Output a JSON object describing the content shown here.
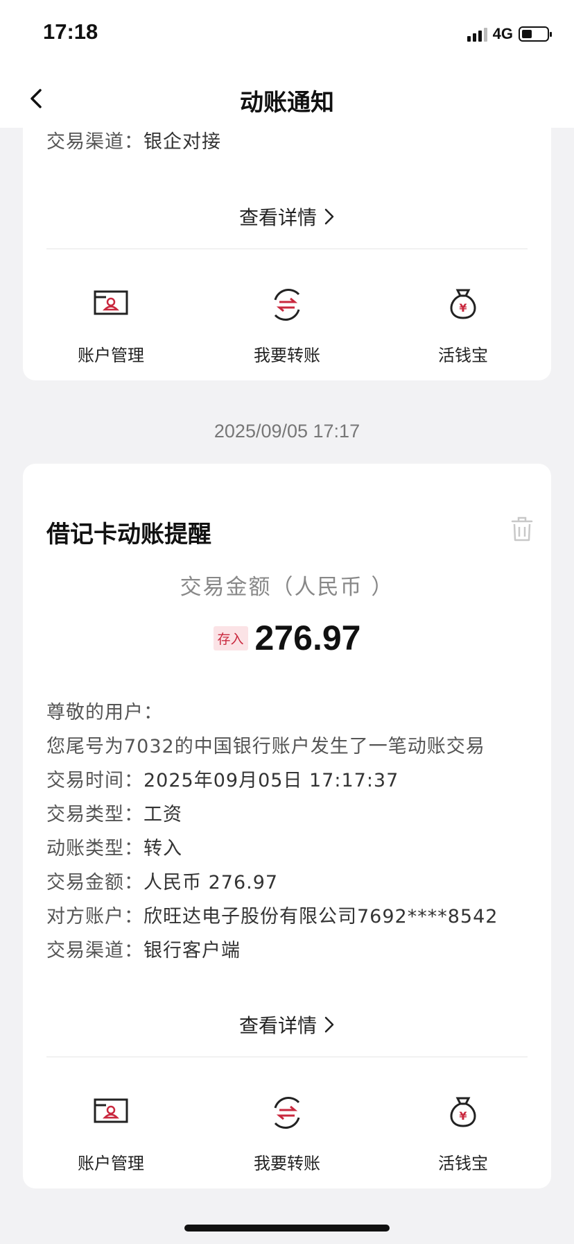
{
  "status_bar": {
    "time": "17:18",
    "network": "4G",
    "battery_level": 0.4
  },
  "nav": {
    "title": "动账通知"
  },
  "top_card": {
    "channel_label": "交易渠道：",
    "channel_value": "银企对接",
    "detail_link": "查看详情"
  },
  "actions": [
    {
      "label": "账户管理",
      "icon": "account-card-icon"
    },
    {
      "label": "我要转账",
      "icon": "transfer-icon"
    },
    {
      "label": "活钱宝",
      "icon": "money-bag-icon"
    }
  ],
  "notification": {
    "date": "2025/09/05 17:17",
    "title": "借记卡动账提醒",
    "amount_label": "交易金额（人民币 ）",
    "badge": "存入",
    "amount": "276.97",
    "greeting": "尊敬的用户：",
    "message": "您尾号为7032的中国银行账户发生了一笔动账交易",
    "fields": [
      {
        "label": "交易时间：",
        "value": "2025年09月05日 17:17:37"
      },
      {
        "label": "交易类型：",
        "value": "工资"
      },
      {
        "label": "动账类型：",
        "value": "转入"
      },
      {
        "label": "交易金额：",
        "value": "人民币 276.97"
      },
      {
        "label": "对方账户：",
        "value": "欣旺达电子股份有限公司7692****8542"
      },
      {
        "label": "交易渠道：",
        "value": "银行客户端"
      }
    ],
    "detail_link": "查看详情"
  },
  "colors": {
    "accent": "#c9283e",
    "background": "#f2f2f4"
  }
}
